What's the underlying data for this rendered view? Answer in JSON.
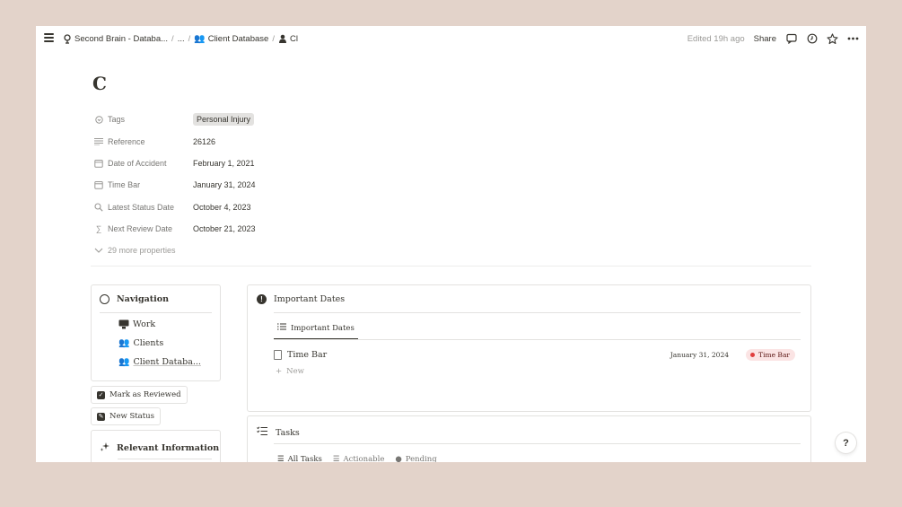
{
  "breadcrumbs": {
    "workspace": "Second Brain - Databa...",
    "ellipsis": "...",
    "database": "Client Database",
    "page": "Cl"
  },
  "topbar": {
    "edited": "Edited 19h ago",
    "share": "Share"
  },
  "page": {
    "title": "C"
  },
  "properties": [
    {
      "name": "Tags",
      "value": "Personal Injury"
    },
    {
      "name": "Reference",
      "value": "26126"
    },
    {
      "name": "Date of Accident",
      "value": "February 1, 2021"
    },
    {
      "name": "Time Bar",
      "value": "January 31, 2024"
    },
    {
      "name": "Latest Status Date",
      "value": "October 4, 2023"
    },
    {
      "name": "Next Review Date",
      "value": "October 21, 2023"
    }
  ],
  "more_properties": "29 more properties",
  "navigation": {
    "title": "Navigation",
    "items": [
      {
        "label": "Work"
      },
      {
        "label": "Clients"
      },
      {
        "label": "Client Databa..."
      }
    ]
  },
  "buttons": {
    "mark_reviewed": "Mark as Reviewed",
    "new_status": "New Status"
  },
  "relevant": {
    "title": "Relevant Information"
  },
  "important_dates": {
    "title": "Important Dates",
    "view_tab": "Important Dates",
    "rows": [
      {
        "title": "Time Bar",
        "date": "January 31, 2024",
        "tag": "Time Bar"
      }
    ],
    "new_label": "New"
  },
  "tasks": {
    "title": "Tasks",
    "tabs": [
      {
        "label": "All Tasks"
      },
      {
        "label": "Actionable"
      },
      {
        "label": "Pending"
      }
    ]
  },
  "help": "?",
  "colors": {
    "background": "#e3d3ca",
    "tag_bg": "#e3e2e0",
    "pill_bg": "#fbe4e4",
    "pill_dot": "#e03e3e"
  }
}
